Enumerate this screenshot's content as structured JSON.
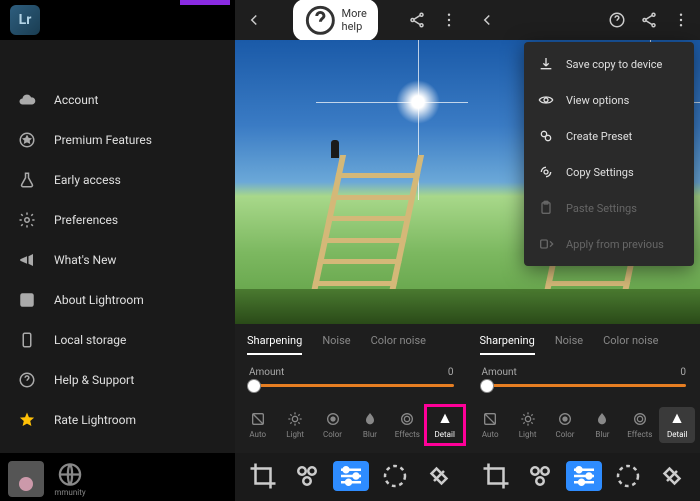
{
  "logo": "Lr",
  "menu": {
    "items": [
      {
        "label": "Account",
        "icon": "cloud-icon"
      },
      {
        "label": "Premium Features",
        "icon": "star-circle-icon"
      },
      {
        "label": "Early access",
        "icon": "flask-icon"
      },
      {
        "label": "Preferences",
        "icon": "gear-icon"
      },
      {
        "label": "What's New",
        "icon": "megaphone-icon"
      },
      {
        "label": "About Lightroom",
        "icon": "lr-badge-icon"
      },
      {
        "label": "Local storage",
        "icon": "device-icon"
      },
      {
        "label": "Help & Support",
        "icon": "help-icon"
      },
      {
        "label": "Rate Lightroom",
        "icon": "star-filled-icon"
      }
    ]
  },
  "bottom": {
    "community_label": "mmunity"
  },
  "editor": {
    "more_help_label": "More help",
    "tabs": [
      {
        "label": "Sharpening",
        "active": true
      },
      {
        "label": "Noise"
      },
      {
        "label": "Color noise"
      }
    ],
    "slider": {
      "name": "Amount",
      "value": "0"
    },
    "tools": [
      {
        "label": "Auto",
        "icon": "auto-icon"
      },
      {
        "label": "Light",
        "icon": "light-icon"
      },
      {
        "label": "Color",
        "icon": "color-icon"
      },
      {
        "label": "Blur",
        "icon": "blur-icon"
      },
      {
        "label": "Effects",
        "icon": "effects-icon"
      },
      {
        "label": "Detail",
        "icon": "detail-icon",
        "active": true
      }
    ],
    "bottombar": [
      "crop-icon",
      "sliders-icon",
      "adjust-icon",
      "swirl-icon",
      "heal-icon"
    ]
  },
  "dropdown": {
    "items": [
      {
        "label": "Save copy to device",
        "icon": "download-icon"
      },
      {
        "label": "View options",
        "icon": "view-options-icon"
      },
      {
        "label": "Create Preset",
        "icon": "preset-icon"
      },
      {
        "label": "Copy Settings",
        "icon": "copy-settings-icon"
      },
      {
        "label": "Paste Settings",
        "icon": "paste-icon",
        "disabled": true
      },
      {
        "label": "Apply from previous",
        "icon": "apply-prev-icon",
        "disabled": true
      }
    ]
  }
}
